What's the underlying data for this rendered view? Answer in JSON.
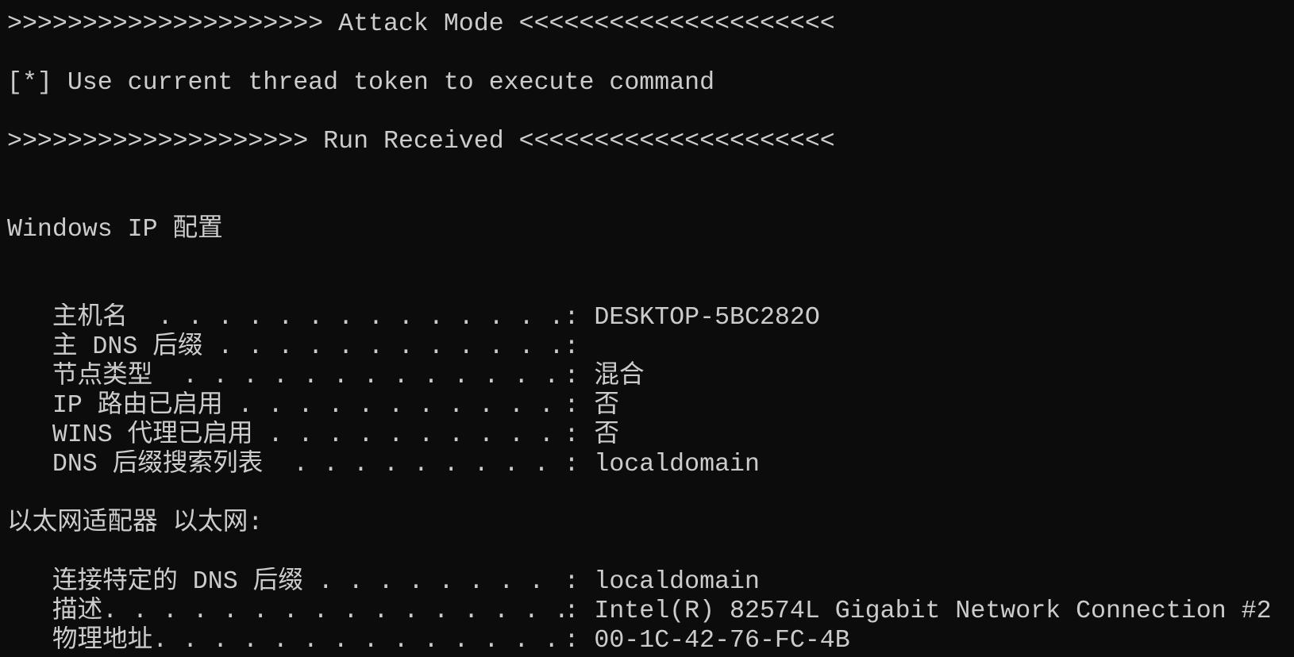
{
  "terminal": {
    "banner_attack": ">>>>>>>>>>>>>>>>>>>>> Attack Mode <<<<<<<<<<<<<<<<<<<<<",
    "info_token": "[*] Use current thread token to execute command",
    "banner_run": ">>>>>>>>>>>>>>>>>>>> Run Received <<<<<<<<<<<<<<<<<<<<<",
    "ip_config_title": "Windows IP 配置",
    "ip_config": [
      {
        "label": "主机名  . . . . . . . . . . . . . .",
        "value": "DESKTOP-5BC282O"
      },
      {
        "label": "主 DNS 后缀 . . . . . . . . . . . .",
        "value": ""
      },
      {
        "label": "节点类型  . . . . . . . . . . . . .",
        "value": "混合"
      },
      {
        "label": "IP 路由已启用 . . . . . . . . . . .",
        "value": "否"
      },
      {
        "label": "WINS 代理已启用 . . . . . . . . . .",
        "value": "否"
      },
      {
        "label": "DNS 后缀搜索列表  . . . . . . . . .",
        "value": "localdomain"
      }
    ],
    "adapter_title": "以太网适配器 以太网:",
    "adapter": [
      {
        "label": "连接特定的 DNS 后缀 . . . . . . . .",
        "value": "localdomain"
      },
      {
        "label": "描述. . . . . . . . . . . . . . . .",
        "value": "Intel(R) 82574L Gigabit Network Connection #2"
      },
      {
        "label": "物理地址. . . . . . . . . . . . . .",
        "value": "00-1C-42-76-FC-4B"
      }
    ]
  },
  "colors": {
    "background": "#0c0c0c",
    "text": "#cccccc"
  }
}
